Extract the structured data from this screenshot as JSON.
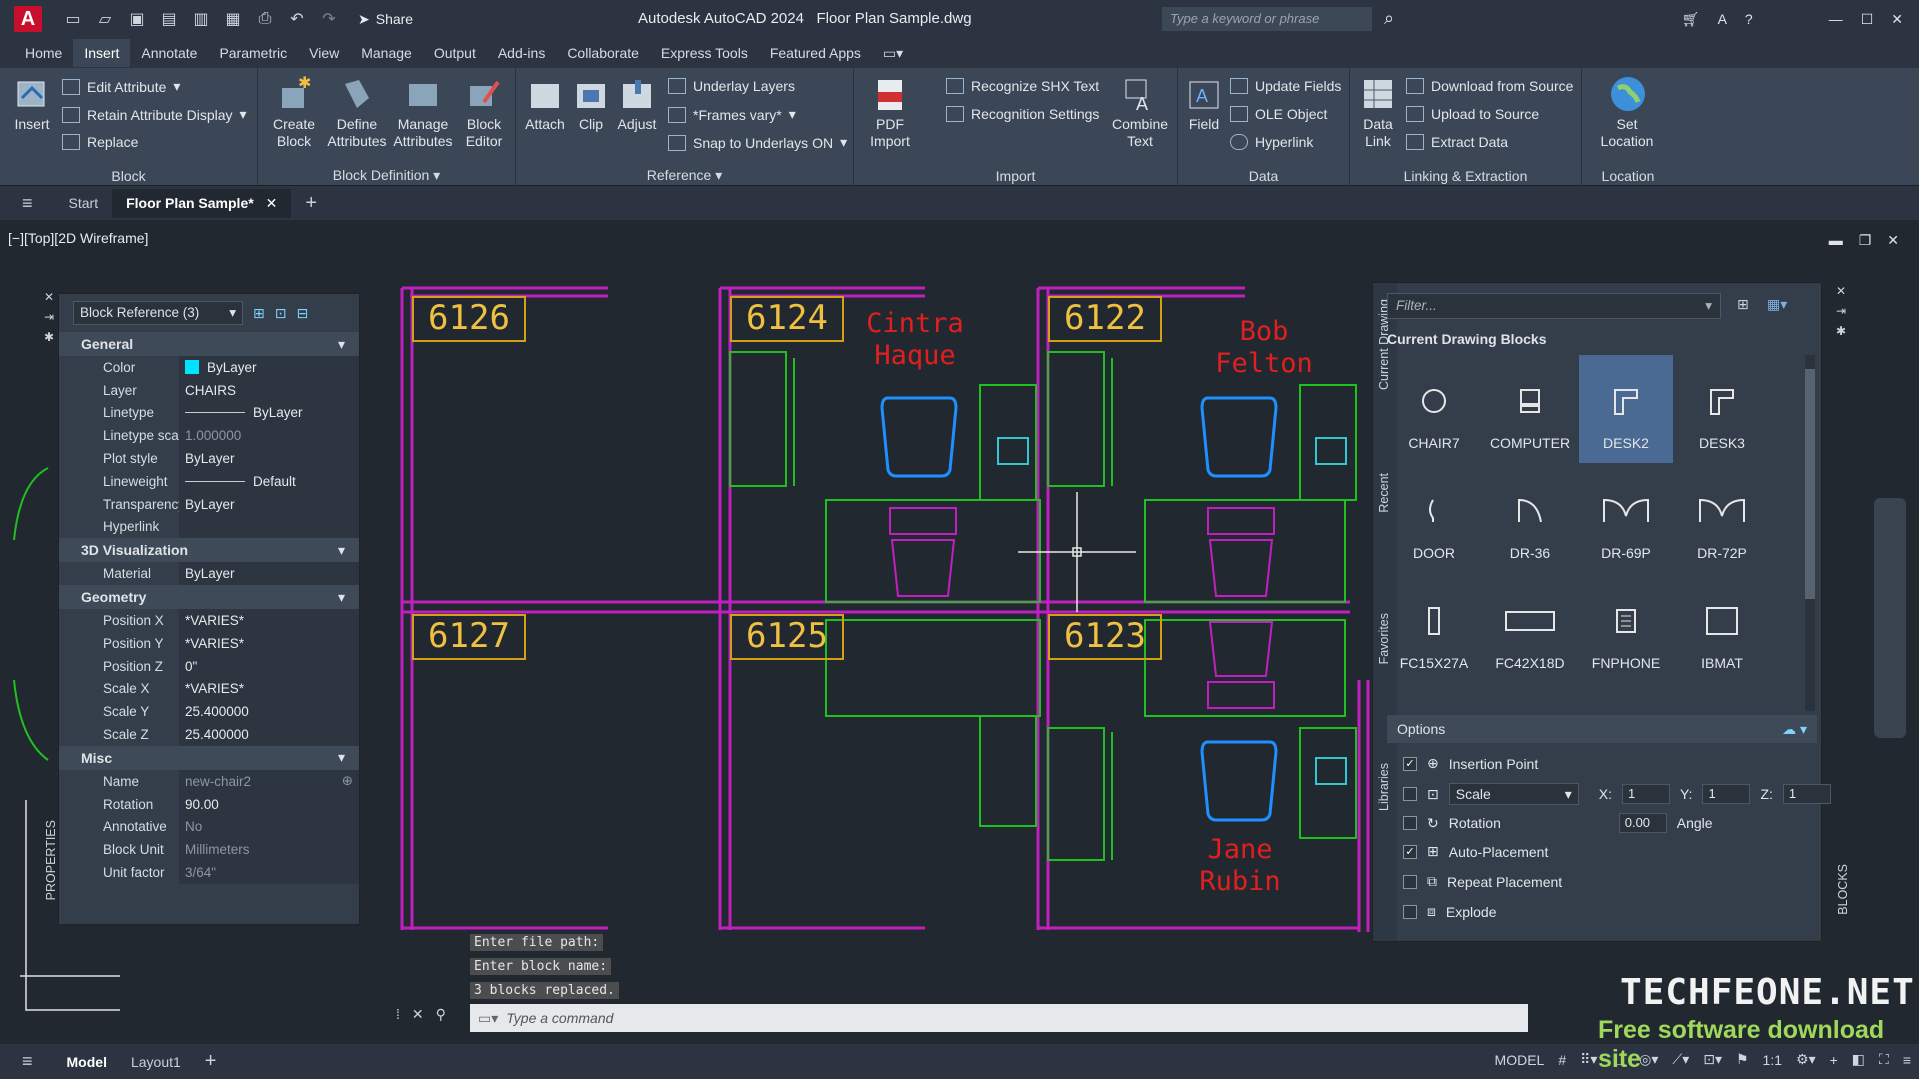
{
  "app": {
    "logo": "A",
    "title": "Autodesk AutoCAD 2024",
    "file": "Floor Plan Sample.dwg",
    "share": "Share",
    "search_placeholder": "Type a keyword or phrase"
  },
  "menu": [
    "Home",
    "Insert",
    "Annotate",
    "Parametric",
    "View",
    "Manage",
    "Output",
    "Add-ins",
    "Collaborate",
    "Express Tools",
    "Featured Apps"
  ],
  "ribbon": {
    "insert": "Insert",
    "edit_attribute": "Edit Attribute",
    "retain_attribute_display": "Retain Attribute Display",
    "replace": "Replace",
    "block_panel": "Block",
    "create_block": "Create\nBlock",
    "define_attributes": "Define\nAttributes",
    "manage_attributes": "Manage\nAttributes",
    "block_editor": "Block\nEditor",
    "block_definition_panel": "Block Definition",
    "attach": "Attach",
    "clip": "Clip",
    "adjust": "Adjust",
    "underlay_layers": "Underlay Layers",
    "frames_vary": "*Frames vary*",
    "snap_to_underlays": "Snap to Underlays ON",
    "reference_panel": "Reference",
    "pdf_import": "PDF\nImport",
    "recognize_shx": "Recognize SHX Text",
    "recognition_settings": "Recognition Settings",
    "combine_text": "Combine\nText",
    "import_panel": "Import",
    "field": "Field",
    "update_fields": "Update Fields",
    "ole_object": "OLE Object",
    "hyperlink": "Hyperlink",
    "data_panel": "Data",
    "data_link": "Data\nLink",
    "download_from_source": "Download from Source",
    "upload_to_source": "Upload to Source",
    "extract_data": "Extract  Data",
    "linking_panel": "Linking & Extraction",
    "set_location": "Set\nLocation",
    "location_panel": "Location"
  },
  "tabs": {
    "start": "Start",
    "active": "Floor Plan Sample*"
  },
  "viewport": {
    "label": "[−][Top][2D Wireframe]"
  },
  "rooms": [
    "6126",
    "6124",
    "6122",
    "6127",
    "6125",
    "6123"
  ],
  "names": {
    "cintra": "Cintra\nHaque",
    "bob": "Bob\nFelton",
    "jane": "Jane\nRubin"
  },
  "properties": {
    "selector": "Block Reference (3)",
    "side_label": "PROPERTIES",
    "general": {
      "title": "General",
      "rows": [
        [
          "Color",
          "ByLayer"
        ],
        [
          "Layer",
          "CHAIRS"
        ],
        [
          "Linetype",
          "ByLayer"
        ],
        [
          "Linetype sca...",
          "1.000000"
        ],
        [
          "Plot style",
          "ByLayer"
        ],
        [
          "Lineweight",
          "Default"
        ],
        [
          "Transparency",
          "ByLayer"
        ],
        [
          "Hyperlink",
          ""
        ]
      ]
    },
    "viz": {
      "title": "3D Visualization",
      "rows": [
        [
          "Material",
          "ByLayer"
        ]
      ]
    },
    "geometry": {
      "title": "Geometry",
      "rows": [
        [
          "Position X",
          "*VARIES*"
        ],
        [
          "Position Y",
          "*VARIES*"
        ],
        [
          "Position Z",
          "0\""
        ],
        [
          "Scale X",
          "*VARIES*"
        ],
        [
          "Scale Y",
          "25.400000"
        ],
        [
          "Scale Z",
          "25.400000"
        ]
      ]
    },
    "misc": {
      "title": "Misc",
      "rows": [
        [
          "Name",
          "new-chair2"
        ],
        [
          "Rotation",
          "90.00"
        ],
        [
          "Annotative",
          "No"
        ],
        [
          "Block Unit",
          "Millimeters"
        ],
        [
          "Unit factor",
          "3/64\""
        ]
      ]
    }
  },
  "blocks": {
    "filter": "Filter...",
    "heading": "Current Drawing Blocks",
    "vtabs": [
      "Current Drawing",
      "Recent",
      "Favorites",
      "Libraries"
    ],
    "side_label": "BLOCKS",
    "items": [
      "CHAIR7",
      "COMPUTER",
      "DESK2",
      "DESK3",
      "DOOR",
      "DR-36",
      "DR-69P",
      "DR-72P",
      "FC15X27A",
      "FC42X18D",
      "FNPHONE",
      "IBMAT"
    ],
    "selected_index": 2,
    "options_title": "Options",
    "insertion_point": "Insertion Point",
    "scale": "Scale",
    "x_label": "X:",
    "y_label": "Y:",
    "z_label": "Z:",
    "x": "1",
    "y": "1",
    "z": "1",
    "rotation": "Rotation",
    "rotation_value": "0.00",
    "angle": "Angle",
    "auto_placement": "Auto-Placement",
    "repeat_placement": "Repeat Placement",
    "explode": "Explode",
    "checked": {
      "insertion_point": true,
      "scale": false,
      "rotation": false,
      "auto_placement": true,
      "repeat_placement": false,
      "explode": false
    }
  },
  "command": {
    "history": [
      "Enter file path:",
      "Enter block name:",
      "3 blocks replaced."
    ],
    "placeholder": "Type a command"
  },
  "status": {
    "model": "Model",
    "layout1": "Layout1",
    "model_right": "MODEL",
    "scale": "1:1"
  },
  "watermark": {
    "line1": "TECHFEONE.NET",
    "line2": "Free software download site"
  },
  "colors": {
    "room": "#d4a017",
    "wall": "#c020c0",
    "furniture": "#20c020",
    "chair": "#1e90ff",
    "name": "#e02020"
  }
}
